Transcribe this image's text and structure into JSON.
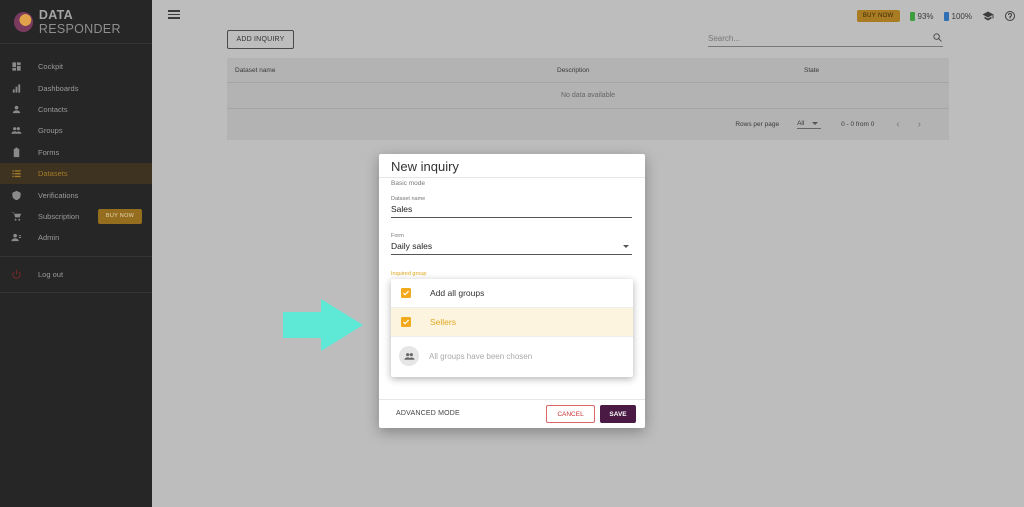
{
  "brand": {
    "bold": "DATA",
    "rest": "RESPONDER"
  },
  "sidebar": {
    "items": [
      {
        "label": "Cockpit",
        "icon": "dashboard-icon"
      },
      {
        "label": "Dashboards",
        "icon": "bar-chart-icon"
      },
      {
        "label": "Contacts",
        "icon": "person-icon"
      },
      {
        "label": "Groups",
        "icon": "group-icon"
      },
      {
        "label": "Forms",
        "icon": "clipboard-icon"
      },
      {
        "label": "Datasets",
        "icon": "list-icon",
        "active": true
      },
      {
        "label": "Verifications",
        "icon": "shield-icon"
      },
      {
        "label": "Subscription",
        "icon": "cart-icon",
        "badge": "BUY NOW"
      },
      {
        "label": "Admin",
        "icon": "admin-icon"
      }
    ],
    "logout": "Log out"
  },
  "topbar": {
    "buy_now": "BUY NOW",
    "battery1": "93%",
    "battery2": "100%"
  },
  "content": {
    "add_inquiry": "ADD INQUIRY",
    "search_placeholder": "Search...",
    "table": {
      "columns": [
        "Dataset name",
        "Description",
        "State"
      ],
      "empty": "No data available",
      "rows_per_page_label": "Rows per page",
      "rows_per_page_value": "All",
      "range": "0 - 0 from 0"
    }
  },
  "modal": {
    "title": "New inquiry",
    "mode": "Basic mode",
    "dataset_name": {
      "label": "Dataset name",
      "value": "Sales"
    },
    "form": {
      "label": "Form",
      "value": "Daily sales"
    },
    "group_label": "Inquired group",
    "advanced": "ADVANCED MODE",
    "cancel": "CANCEL",
    "save": "SAVE"
  },
  "dropdown": {
    "items": [
      {
        "label": "Add all groups",
        "checked": true
      },
      {
        "label": "Sellers",
        "checked": true,
        "selected": true
      }
    ],
    "empty": "All groups have been chosen"
  },
  "colors": {
    "accent": "#f2a91c",
    "arrow": "#5ee8d6",
    "save": "#4a1a45"
  }
}
